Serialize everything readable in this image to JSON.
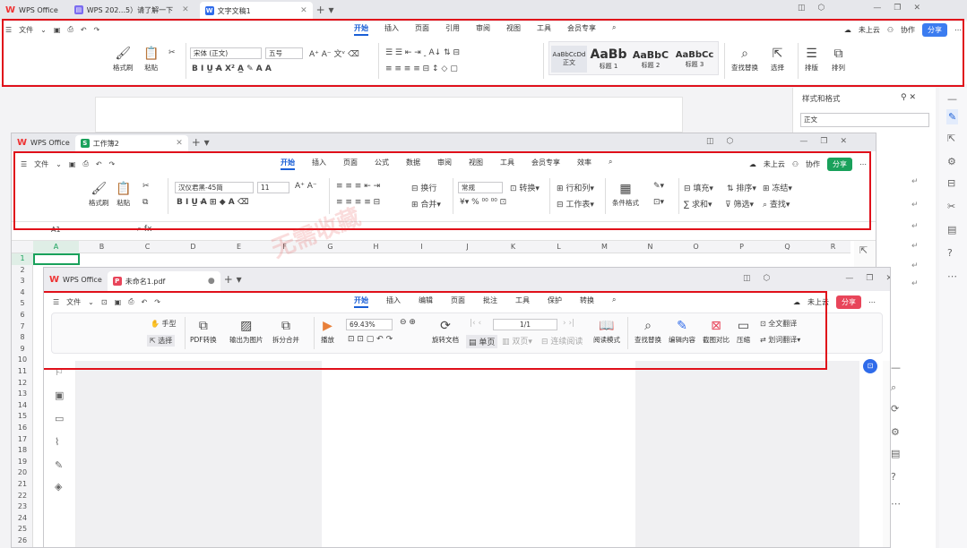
{
  "colors": {
    "accent": "#1a5fd6",
    "red_box": "#e0101a",
    "share_blue": "#3b7cf0",
    "share_green": "#19a15b",
    "share_red": "#e8455a",
    "wps_red": "#e33333"
  },
  "writer": {
    "tabs": [
      {
        "label": "WPS Office"
      },
      {
        "label": "WPS 202...5）请了解一下"
      },
      {
        "label": "文字文稿1"
      }
    ],
    "menu": {
      "file": "文件",
      "items": [
        "开始",
        "插入",
        "页面",
        "引用",
        "审阅",
        "视图",
        "工具",
        "会员专享"
      ],
      "cloud": "未上云",
      "collab": "协作",
      "share": "分享"
    },
    "ribbon": {
      "format_painter": "格式刷",
      "paste": "粘贴",
      "font_name": "宋体 (正文)",
      "font_size": "五号",
      "styles": [
        {
          "preview": "AaBbCcDd",
          "name": "正文"
        },
        {
          "preview": "AaBb",
          "name": "标题 1"
        },
        {
          "preview": "AaBbC",
          "name": "标题 2"
        },
        {
          "preview": "AaBbCc",
          "name": "标题 3"
        }
      ],
      "find_replace": "查找替换",
      "select": "选择",
      "layout": "排版",
      "arrange": "排列"
    },
    "side_panel": {
      "title": "样式和格式",
      "current": "正文"
    }
  },
  "sheet": {
    "tabs": [
      {
        "label": "WPS Office"
      },
      {
        "label": "工作簿2"
      }
    ],
    "menu": {
      "file": "文件",
      "items": [
        "开始",
        "插入",
        "页面",
        "公式",
        "数据",
        "审阅",
        "视图",
        "工具",
        "会员专享",
        "效率"
      ],
      "cloud": "未上云",
      "collab": "协作",
      "share": "分享"
    },
    "ribbon": {
      "format_painter": "格式刷",
      "paste": "粘贴",
      "font_name": "汉仪君黑-45简",
      "font_size": "11",
      "wrap": "换行",
      "merge": "合并",
      "number_format": "常规",
      "convert": "转换",
      "rows_cols": "行和列",
      "worksheet": "工作表",
      "cond_format": "条件格式",
      "fill": "填充",
      "sort": "排序",
      "freeze": "冻结",
      "sum": "求和",
      "filter": "筛选",
      "find": "查找"
    },
    "name_box": "A1",
    "columns": [
      "A",
      "B",
      "C",
      "D",
      "E",
      "F",
      "G",
      "H",
      "I",
      "J",
      "K",
      "L",
      "M",
      "N",
      "O",
      "P",
      "Q",
      "R"
    ],
    "rows": [
      "1",
      "2",
      "3",
      "4",
      "5",
      "6",
      "7",
      "8",
      "9",
      "10",
      "11",
      "12",
      "13",
      "14",
      "15",
      "16",
      "17",
      "18",
      "19",
      "20",
      "21",
      "22",
      "23",
      "24",
      "25",
      "26"
    ]
  },
  "pdf": {
    "tabs": [
      {
        "label": "WPS Office"
      },
      {
        "label": "未命名1.pdf"
      }
    ],
    "menu": {
      "file": "文件",
      "items": [
        "开始",
        "插入",
        "编辑",
        "页面",
        "批注",
        "工具",
        "保护",
        "转换"
      ],
      "cloud": "未上云",
      "share": "分享"
    },
    "ribbon": {
      "hand": "手型",
      "select": "选择",
      "pdf_convert": "PDF转换",
      "export_image": "输出为图片",
      "split_merge": "拆分合并",
      "play": "播放",
      "zoom": "69.43%",
      "page": "1/1",
      "rotate": "旋转文档",
      "single": "单页",
      "double": "双页",
      "continuous": "连续阅读",
      "read_mode": "阅读模式",
      "find_replace": "查找替换",
      "edit_content": "编辑内容",
      "screenshot_compare": "截图对比",
      "compress": "压缩",
      "full_translate": "全文翻译",
      "word_translate": "划词翻译"
    }
  },
  "watermark": "无需收藏"
}
